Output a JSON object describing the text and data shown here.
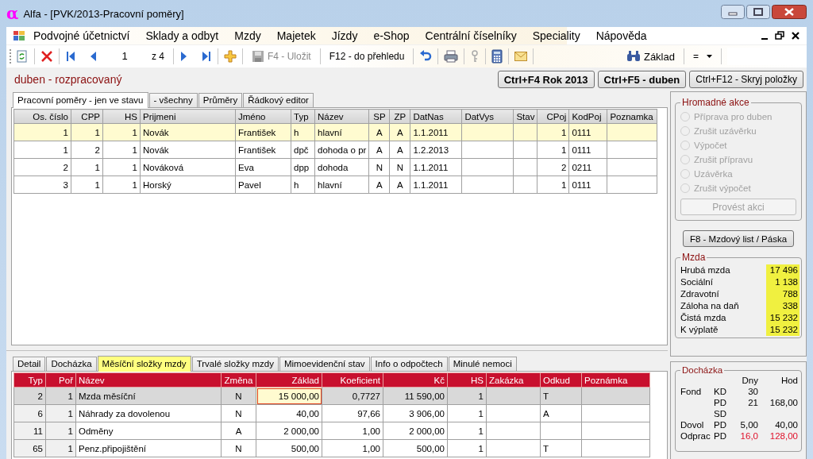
{
  "window": {
    "logo": "α",
    "title": "Alfa - [PVK/2013-Pracovní poměry]"
  },
  "menu": {
    "items": [
      "Podvojné účetnictví",
      "Sklady a odbyt",
      "Mzdy",
      "Majetek",
      "Jízdy",
      "e-Shop",
      "Centrální číselníky",
      "Speciality",
      "Nápověda"
    ]
  },
  "toolbar": {
    "record": "1",
    "record_total": "z 4",
    "save": "F4 - Uložit",
    "overview": "F12 - do přehledu",
    "filter": "Základ",
    "operator": "="
  },
  "status": "duben - rozpracovaný",
  "header_buttons": [
    {
      "label": "Ctrl+F4 Rok 2013",
      "kind": "strong"
    },
    {
      "label": "Ctrl+F5 - duben",
      "kind": "strong"
    },
    {
      "label": "Ctrl+F12 - Skryj položky",
      "kind": "normal"
    }
  ],
  "upper_tabs": [
    {
      "label": "Pracovní poměry - jen ve stavu",
      "selected": true
    },
    {
      "label": "- všechny",
      "selected": false
    },
    {
      "label": "Průměry",
      "selected": false
    },
    {
      "label": "Řádkový editor",
      "selected": false
    }
  ],
  "employees": {
    "columns": [
      "Os. číslo",
      "CPP",
      "HS",
      "Prijmeni",
      "Jméno",
      "Typ",
      "Název",
      "SP",
      "ZP",
      "DatNas",
      "DatVys",
      "Stav",
      "CPoj",
      "KodPoj",
      "Poznamka"
    ],
    "rows": [
      {
        "selected": true,
        "cells": [
          "1",
          "1",
          "1",
          "Novák",
          "František",
          "h",
          "hlavní",
          "A",
          "A",
          "1.1.2011",
          "",
          "",
          "1",
          "0111",
          ""
        ]
      },
      {
        "selected": false,
        "cells": [
          "1",
          "2",
          "1",
          "Novák",
          "František",
          "dpč",
          "dohoda o pr",
          "A",
          "A",
          "1.2.2013",
          "",
          "",
          "1",
          "0111",
          ""
        ]
      },
      {
        "selected": false,
        "cells": [
          "2",
          "1",
          "1",
          "Nováková",
          "Eva",
          "dpp",
          "dohoda",
          "N",
          "N",
          "1.1.2011",
          "",
          "",
          "2",
          "0211",
          ""
        ]
      },
      {
        "selected": false,
        "cells": [
          "3",
          "1",
          "1",
          "Horský",
          "Pavel",
          "h",
          "hlavní",
          "A",
          "A",
          "1.1.2011",
          "",
          "",
          "1",
          "0111",
          ""
        ]
      }
    ]
  },
  "lower_tabs": [
    {
      "label": "Detail",
      "selected": false
    },
    {
      "label": "Docházka",
      "selected": false
    },
    {
      "label": "Měsíční složky mzdy",
      "selected": true
    },
    {
      "label": "Trvalé složky mzdy",
      "selected": false
    },
    {
      "label": "Mimoevidenční stav",
      "selected": false
    },
    {
      "label": "Info o odpočtech",
      "selected": false
    },
    {
      "label": "Minulé nemoci",
      "selected": false
    }
  ],
  "wage_items": {
    "columns": [
      "Typ",
      "Poř",
      "Název",
      "Změna",
      "Základ",
      "Koeficient",
      "Kč",
      "HS",
      "Zakázka",
      "Odkud",
      "Poznámka"
    ],
    "rows": [
      {
        "selected": true,
        "cells": [
          "2",
          "1",
          "Mzda měsíční",
          "N",
          "15 000,00",
          "0,7727",
          "11 590,00",
          "1",
          "",
          "T",
          ""
        ]
      },
      {
        "selected": false,
        "cells": [
          "6",
          "1",
          "Náhrady za dovolenou",
          "N",
          "40,00",
          "97,66",
          "3 906,00",
          "1",
          "",
          "A",
          ""
        ]
      },
      {
        "selected": false,
        "cells": [
          "11",
          "1",
          "Odměny",
          "A",
          "2 000,00",
          "1,00",
          "2 000,00",
          "1",
          "",
          "",
          ""
        ]
      },
      {
        "selected": false,
        "cells": [
          "65",
          "1",
          "Penz.připojištění",
          "N",
          "500,00",
          "1,00",
          "500,00",
          "1",
          "",
          "T",
          ""
        ]
      }
    ]
  },
  "mass_actions": {
    "title": "Hromadné akce",
    "options": [
      {
        "label": "Příprava pro duben",
        "selected": false,
        "disabled": true
      },
      {
        "label": "Zrušit uzávěrku",
        "selected": false,
        "disabled": true
      },
      {
        "label": "Výpočet",
        "selected": false,
        "disabled": true
      },
      {
        "label": "Zrušit přípravu",
        "selected": false,
        "disabled": true
      },
      {
        "label": "Uzávěrka",
        "selected": false,
        "disabled": true
      },
      {
        "label": "Zrušit výpočet",
        "selected": false,
        "disabled": true
      }
    ],
    "button": {
      "label": "Provést akci",
      "disabled": true
    }
  },
  "payslip_button": "F8 - Mzdový list / Páska",
  "wage": {
    "title": "Mzda",
    "rows": [
      {
        "label": "Hrubá mzda",
        "value": "17 496"
      },
      {
        "label": "Sociální",
        "value": "1 138"
      },
      {
        "label": "Zdravotní",
        "value": "788"
      },
      {
        "label": "Záloha na daň",
        "value": "338"
      },
      {
        "label": "Čistá mzda",
        "value": "15 232"
      },
      {
        "label": "K výplatě",
        "value": "15 232"
      }
    ]
  },
  "attendance": {
    "title": "Docházka",
    "headers": [
      "Dny",
      "Hod"
    ],
    "rows": [
      {
        "label": "Fond",
        "code": "KD",
        "days": "30",
        "highlight": false
      },
      {
        "code": "PD",
        "days": "21",
        "hours": "168,00",
        "highlight": false
      },
      {
        "code": "SD"
      },
      {
        "label": "Dovol",
        "code": "PD",
        "days": "5,00",
        "hours": "40,00",
        "highlight": false
      },
      {
        "label": "Odprac",
        "code": "PD",
        "days": "16,0",
        "hours": "128,00",
        "highlight": true
      }
    ]
  }
}
